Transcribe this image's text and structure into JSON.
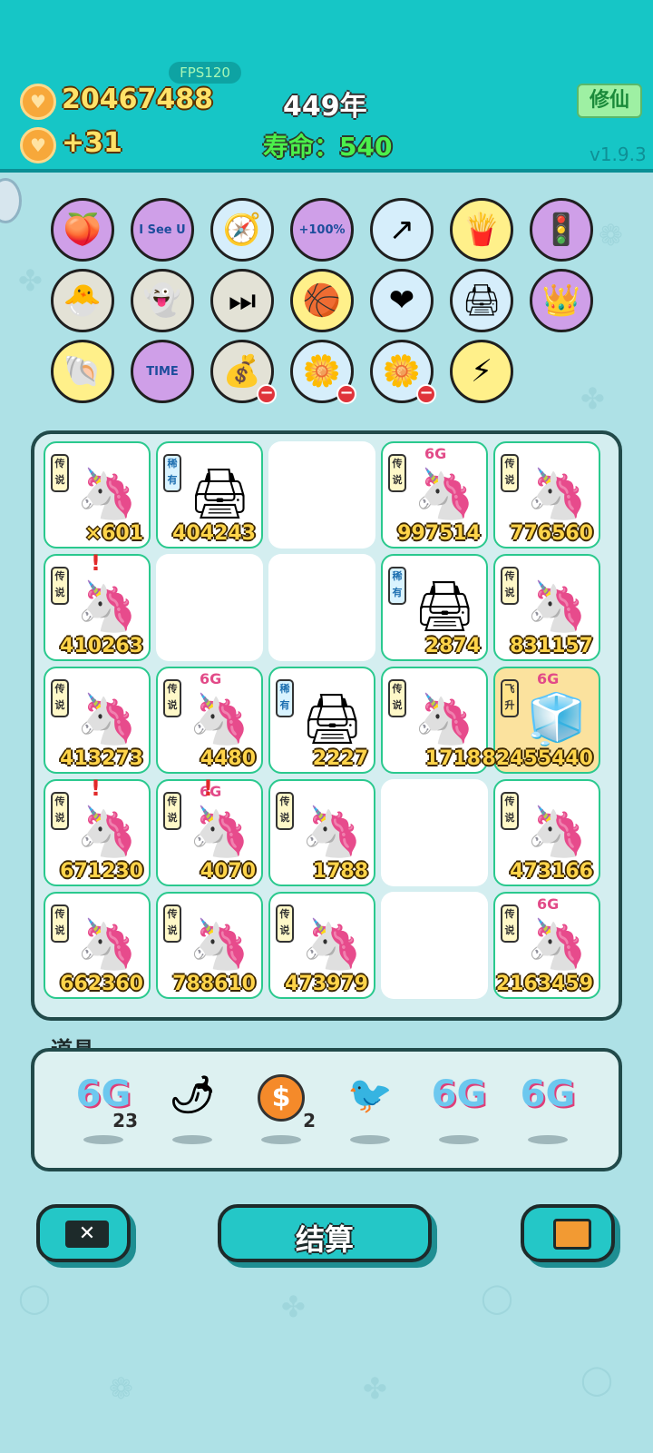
{
  "header": {
    "fps": "FPS120",
    "coins": "20467488",
    "income": "+31",
    "year": "449年",
    "life": "寿命：540",
    "xiuxian_label": "修仙",
    "version": "v1.9.3"
  },
  "skills": [
    {
      "name": "sunglasses-peach-icon",
      "color": "#cf9fe8"
    },
    {
      "name": "i-see-u-icon",
      "color": "#cf9fe8",
      "text": "I See U"
    },
    {
      "name": "compass-icon",
      "color": "#d6eefb"
    },
    {
      "name": "bubble-tea-icon",
      "color": "#cf9fe8",
      "text": "+100%"
    },
    {
      "name": "growth-arrow-icon",
      "color": "#d6eefb"
    },
    {
      "name": "fries-icon",
      "color": "#fff08a"
    },
    {
      "name": "traffic-light-icon",
      "color": "#cf9fe8"
    },
    {
      "name": "chick-egg-icon",
      "color": "#e3e2d6"
    },
    {
      "name": "ghost-icon",
      "color": "#e3e2d6"
    },
    {
      "name": "skip-icon",
      "color": "#e3e2d6"
    },
    {
      "name": "basketballs-icon",
      "color": "#fff08a"
    },
    {
      "name": "heart-potion-icon",
      "color": "#d6eefb"
    },
    {
      "name": "printer-warning-icon",
      "color": "#d6eefb"
    },
    {
      "name": "crown-box-icon",
      "color": "#cf9fe8"
    },
    {
      "name": "shell-icon",
      "color": "#fff08a"
    },
    {
      "name": "time-magazine-icon",
      "color": "#cf9fe8",
      "text": "TIME"
    },
    {
      "name": "money-bag-icon",
      "color": "#e3e2d6"
    },
    {
      "name": "flower-pot-icon",
      "color": "#d6eefb"
    },
    {
      "name": "flower-pot-icon",
      "color": "#d6eefb"
    },
    {
      "name": "lightning-icon",
      "color": "#fff08a"
    }
  ],
  "board": {
    "cells": [
      {
        "type": "unicorn",
        "tag": "传说",
        "value": "×601"
      },
      {
        "type": "printer",
        "tag": "稀有",
        "value": "404243"
      },
      {
        "type": "empty"
      },
      {
        "type": "unicorn",
        "tag": "传说",
        "value": "997514",
        "badge": "6G"
      },
      {
        "type": "unicorn",
        "tag": "传说",
        "value": "776560"
      },
      {
        "type": "unicorn",
        "tag": "传说",
        "value": "410263",
        "alert": "!"
      },
      {
        "type": "empty"
      },
      {
        "type": "empty"
      },
      {
        "type": "printer",
        "tag": "稀有",
        "value": "2874"
      },
      {
        "type": "unicorn",
        "tag": "传说",
        "value": "831157"
      },
      {
        "type": "unicorn",
        "tag": "传说",
        "value": "413273"
      },
      {
        "type": "unicorn",
        "tag": "传说",
        "value": "4480",
        "badge": "6G"
      },
      {
        "type": "printer",
        "tag": "稀有",
        "value": "2227"
      },
      {
        "type": "unicorn",
        "tag": "传说",
        "value": "1718"
      },
      {
        "type": "fridge",
        "tag": "飞升",
        "value": "82455440",
        "badge": "6G"
      },
      {
        "type": "unicorn",
        "tag": "传说",
        "value": "671230",
        "alert": "!"
      },
      {
        "type": "unicorn",
        "tag": "传说",
        "value": "4070",
        "badge": "6G",
        "alert": "!"
      },
      {
        "type": "unicorn",
        "tag": "传说",
        "value": "1788"
      },
      {
        "type": "empty"
      },
      {
        "type": "unicorn",
        "tag": "传说",
        "value": "473166"
      },
      {
        "type": "unicorn",
        "tag": "传说",
        "value": "662360"
      },
      {
        "type": "unicorn",
        "tag": "传说",
        "value": "788610"
      },
      {
        "type": "unicorn",
        "tag": "传说",
        "value": "473979"
      },
      {
        "type": "empty"
      },
      {
        "type": "unicorn",
        "tag": "传说",
        "value": "2163459",
        "badge": "6G"
      }
    ]
  },
  "items": {
    "title": "道具",
    "list": [
      {
        "name": "6g-item",
        "glyph": "6G",
        "count": "23"
      },
      {
        "name": "chili-item",
        "glyph": "🌶",
        "count": ""
      },
      {
        "name": "coin-item",
        "glyph": "$",
        "count": "2"
      },
      {
        "name": "duck-item",
        "glyph": "🐦",
        "count": ""
      },
      {
        "name": "6g-item",
        "glyph": "6G",
        "count": ""
      },
      {
        "name": "6g-item",
        "glyph": "6G",
        "count": ""
      }
    ]
  },
  "buttons": {
    "settle_label": "结算"
  }
}
